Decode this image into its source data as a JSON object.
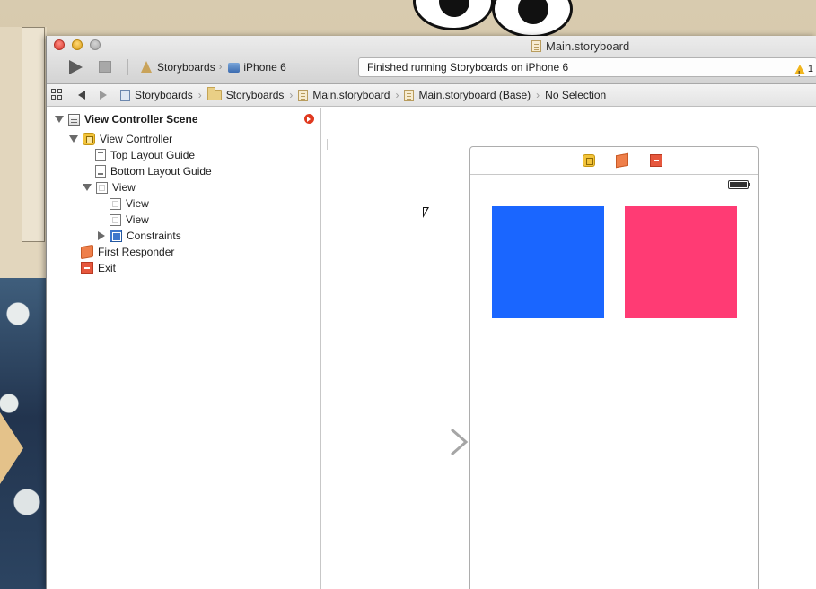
{
  "window": {
    "title": "Main.storyboard"
  },
  "toolbar": {
    "scheme_name": "Storyboards",
    "device_name": "iPhone 6",
    "activity_text": "Finished running Storyboards on iPhone 6",
    "warning_count": "1"
  },
  "jumpbar": {
    "crumbs": [
      "Storyboards",
      "Storyboards",
      "Main.storyboard",
      "Main.storyboard (Base)",
      "No Selection"
    ]
  },
  "outline": {
    "scene_title": "View Controller Scene",
    "items": [
      {
        "label": "View Controller",
        "icon": "view-controller-icon"
      },
      {
        "label": "Top Layout Guide",
        "icon": "top-layout-guide-icon"
      },
      {
        "label": "Bottom Layout Guide",
        "icon": "bottom-layout-guide-icon"
      },
      {
        "label": "View",
        "icon": "view-icon"
      },
      {
        "label": "View",
        "icon": "view-icon"
      },
      {
        "label": "View",
        "icon": "view-icon"
      },
      {
        "label": "Constraints",
        "icon": "constraints-icon"
      },
      {
        "label": "First Responder",
        "icon": "first-responder-icon"
      },
      {
        "label": "Exit",
        "icon": "exit-icon"
      }
    ]
  },
  "canvas": {
    "boxes": [
      {
        "color": "#1a66ff"
      },
      {
        "color": "#ff3b74"
      }
    ]
  },
  "colors": {
    "accent": "#1a66ff",
    "pink": "#ff3b74",
    "warning": "#f1b51b"
  }
}
